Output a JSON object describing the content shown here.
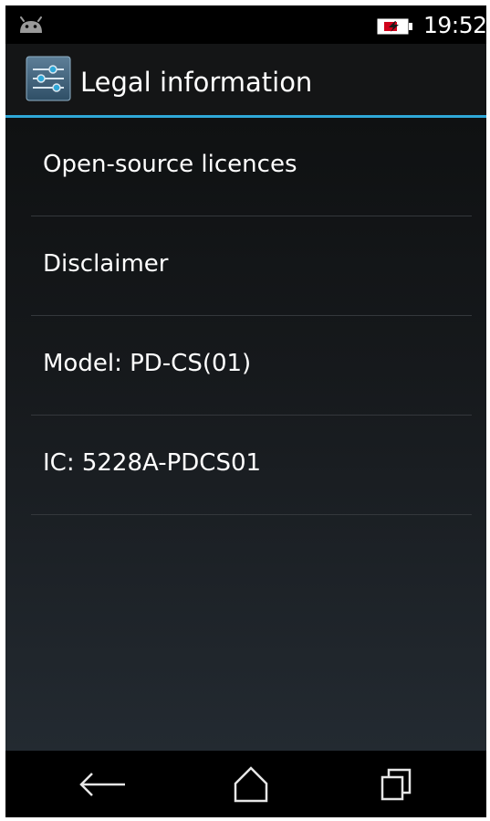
{
  "status_bar": {
    "time": "19:52",
    "notification_icon": "android-icon",
    "battery_icon": "battery-charging-icon"
  },
  "action_bar": {
    "app_icon": "settings-icon",
    "title": "Legal information",
    "accent_color": "#2fa8d8"
  },
  "list": {
    "items": [
      {
        "label": "Open-source licences"
      },
      {
        "label": "Disclaimer"
      },
      {
        "label": "Model: PD-CS(01)"
      },
      {
        "label": "IC: 5228A-PDCS01"
      }
    ]
  },
  "nav_bar": {
    "buttons": [
      "back-icon",
      "home-icon",
      "recents-icon"
    ]
  }
}
